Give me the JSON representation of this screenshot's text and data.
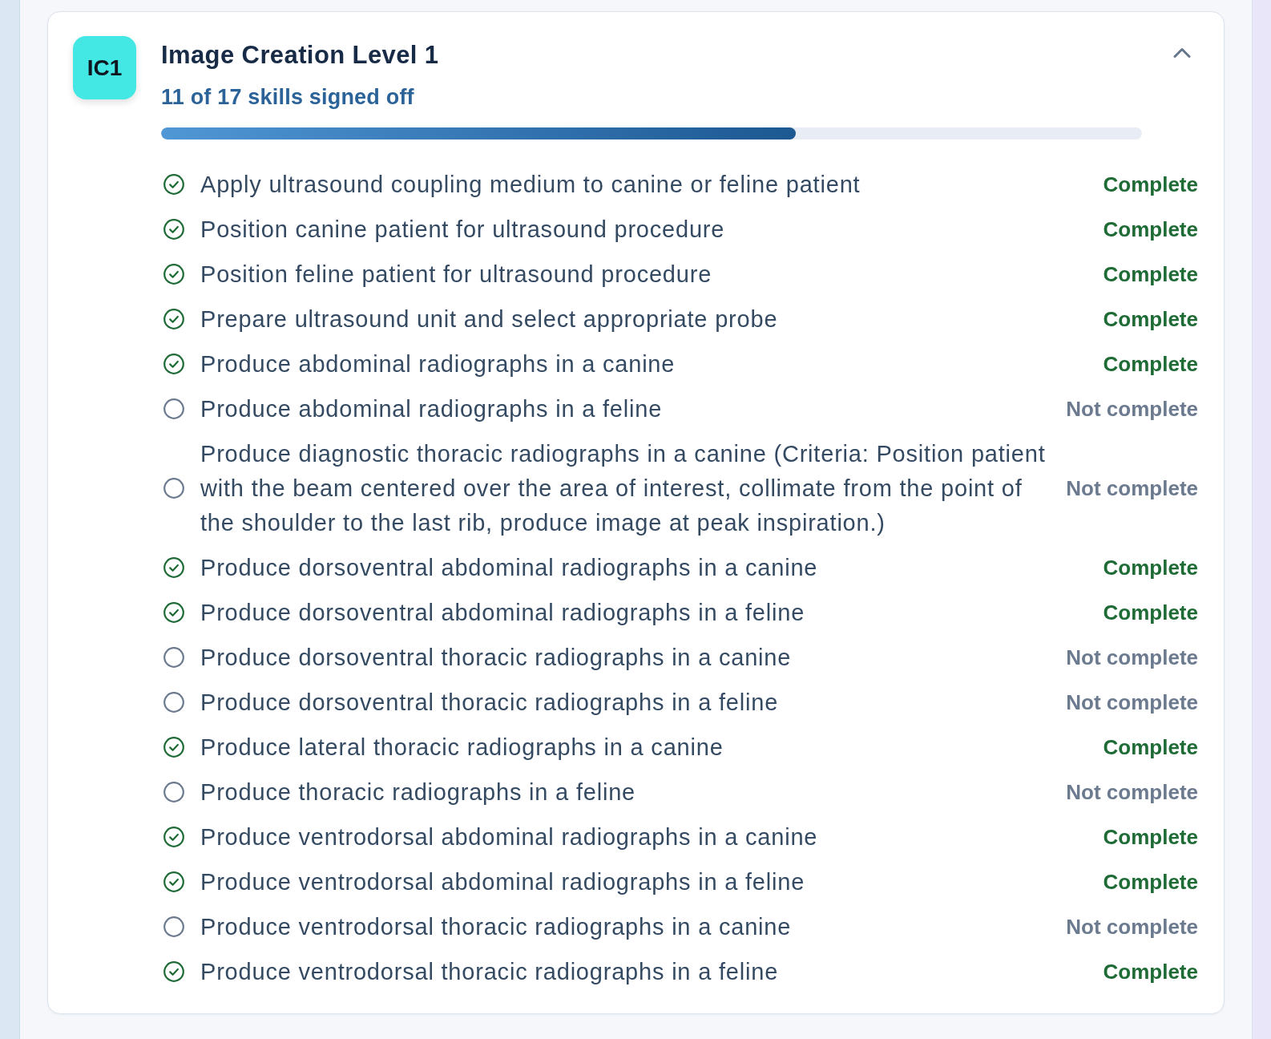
{
  "card": {
    "badge": "IC1",
    "title": "Image Creation Level 1",
    "subtitle": "11 of 17 skills signed off",
    "expanded": true,
    "progress": {
      "level": 0.647
    },
    "skills": [
      {
        "name": "Apply ultrasound coupling medium to canine or feline patient",
        "complete": true,
        "status": "Complete"
      },
      {
        "name": "Position canine patient for ultrasound procedure",
        "complete": true,
        "status": "Complete"
      },
      {
        "name": "Position feline patient for ultrasound procedure",
        "complete": true,
        "status": "Complete"
      },
      {
        "name": "Prepare ultrasound unit and select appropriate probe",
        "complete": true,
        "status": "Complete"
      },
      {
        "name": "Produce abdominal radiographs in a canine",
        "complete": true,
        "status": "Complete"
      },
      {
        "name": "Produce abdominal radiographs in a feline",
        "complete": false,
        "status": "Not complete"
      },
      {
        "name": "Produce diagnostic thoracic radiographs in a canine (Criteria: Position patient with the beam centered over the area of interest, collimate from the point of the shoulder to the last rib, produce image at peak inspiration.)",
        "complete": false,
        "status": "Not complete"
      },
      {
        "name": "Produce dorsoventral abdominal radiographs in a canine",
        "complete": true,
        "status": "Complete"
      },
      {
        "name": "Produce dorsoventral abdominal radiographs in a feline",
        "complete": true,
        "status": "Complete"
      },
      {
        "name": "Produce dorsoventral thoracic radiographs in a canine",
        "complete": false,
        "status": "Not complete"
      },
      {
        "name": "Produce dorsoventral thoracic radiographs in a feline",
        "complete": false,
        "status": "Not complete"
      },
      {
        "name": "Produce lateral thoracic radiographs in a canine",
        "complete": true,
        "status": "Complete"
      },
      {
        "name": "Produce thoracic radiographs in a feline",
        "complete": false,
        "status": "Not complete"
      },
      {
        "name": "Produce ventrodorsal abdominal radiographs in a canine",
        "complete": true,
        "status": "Complete"
      },
      {
        "name": "Produce ventrodorsal abdominal radiographs in a feline",
        "complete": true,
        "status": "Complete"
      },
      {
        "name": "Produce ventrodorsal thoracic radiographs in a canine",
        "complete": false,
        "status": "Not complete"
      },
      {
        "name": "Produce ventrodorsal thoracic radiographs in a feline",
        "complete": true,
        "status": "Complete"
      }
    ]
  }
}
